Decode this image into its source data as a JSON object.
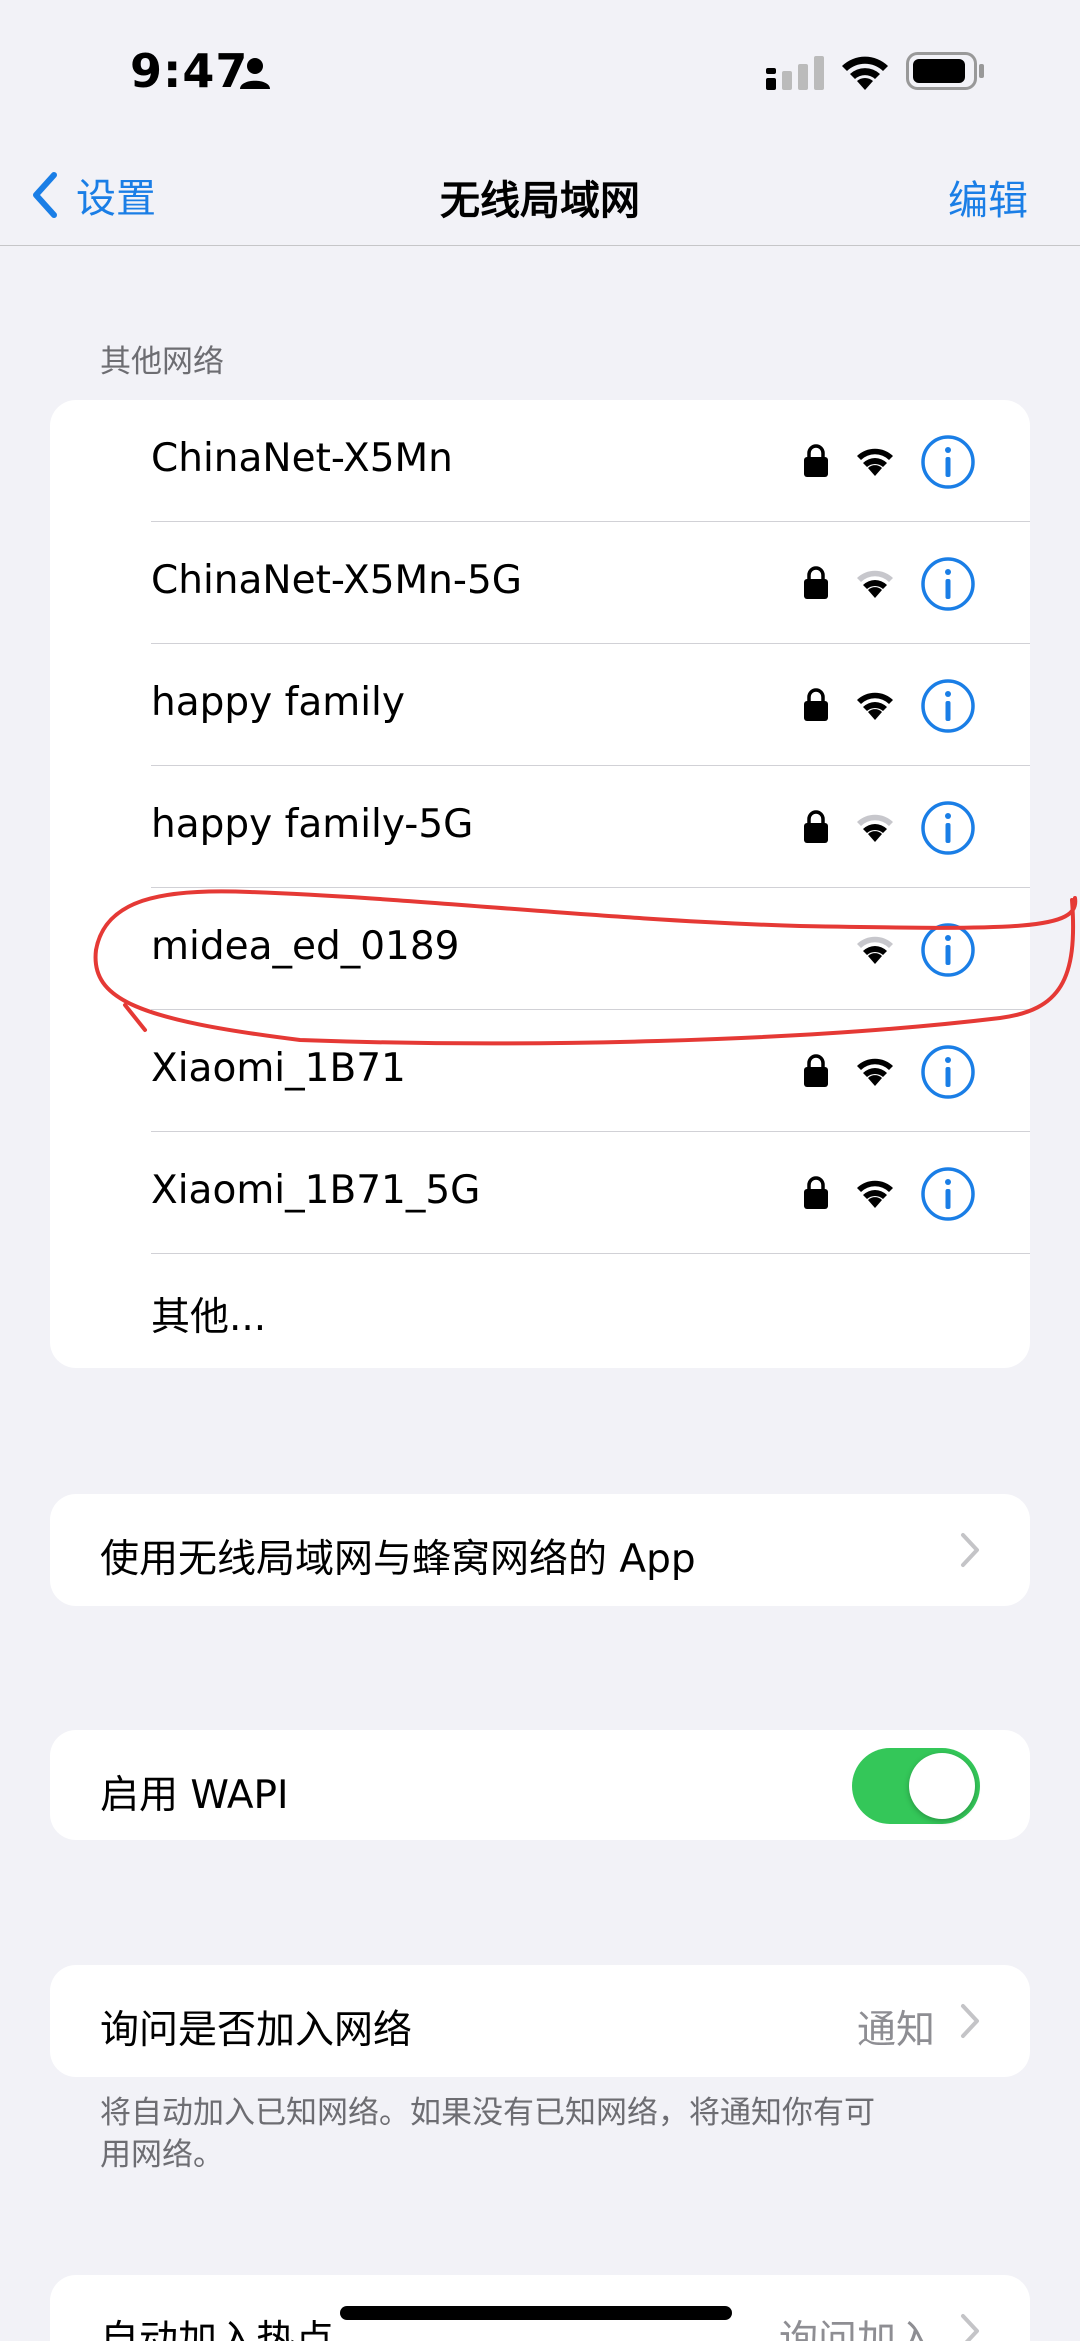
{
  "status_bar": {
    "time": "9:47",
    "icons": [
      "person-icon",
      "cellular-signal-icon",
      "wifi-icon",
      "battery-icon"
    ]
  },
  "nav": {
    "back_label": "设置",
    "title": "无线局域网",
    "edit_label": "编辑"
  },
  "other_networks": {
    "header": "其他网络",
    "items": [
      {
        "name": "ChinaNet-X5Mn",
        "locked": true,
        "signal": "full"
      },
      {
        "name": "ChinaNet-X5Mn-5G",
        "locked": true,
        "signal": "weak"
      },
      {
        "name": "happy family",
        "locked": true,
        "signal": "full"
      },
      {
        "name": "happy family-5G",
        "locked": true,
        "signal": "weak"
      },
      {
        "name": "midea_ed_0189",
        "locked": false,
        "signal": "weak"
      },
      {
        "name": "Xiaomi_1B71",
        "locked": true,
        "signal": "full"
      },
      {
        "name": "Xiaomi_1B71_5G",
        "locked": true,
        "signal": "full"
      }
    ],
    "other_label": "其他..."
  },
  "apps_row": {
    "label": "使用无线局域网与蜂窝网络的 App"
  },
  "wapi_row": {
    "label": "启用 WAPI",
    "enabled": true
  },
  "ask_row": {
    "label": "询问是否加入网络",
    "value": "通知",
    "note": "将自动加入已知网络。如果没有已知网络，将通知你有可用网络。"
  },
  "hotspot_row": {
    "label": "自动加入热点",
    "value": "询问加入"
  },
  "colors": {
    "accent": "#1a7ee6",
    "toggle_on": "#34c759",
    "annotation": "#e53935",
    "background": "#f2f2f7"
  }
}
